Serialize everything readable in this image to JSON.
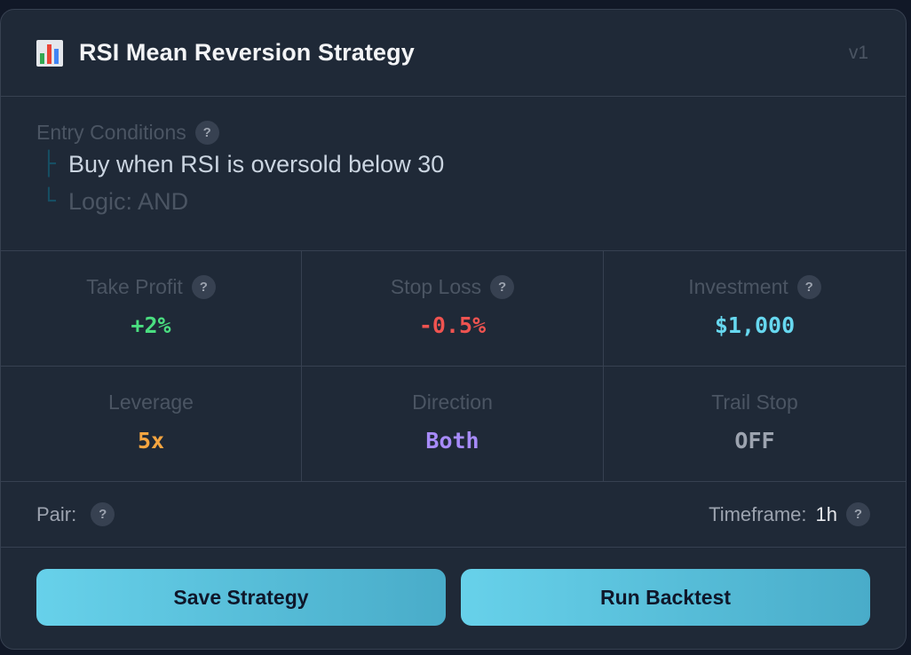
{
  "header": {
    "title": "RSI Mean Reversion Strategy",
    "version": "v1",
    "icon": "bar-chart-icon"
  },
  "entry": {
    "label": "Entry Conditions",
    "help": "?",
    "condition_branch": "├",
    "condition": "Buy when RSI is oversold below 30",
    "logic_branch": "└",
    "logic": "Logic: AND"
  },
  "params": [
    {
      "label": "Take Profit",
      "value": "+2%",
      "color": "#4ade80",
      "help": "?"
    },
    {
      "label": "Stop Loss",
      "value": "-0.5%",
      "color": "#ef5350",
      "help": "?"
    },
    {
      "label": "Investment",
      "value": "$1,000",
      "color": "#67d8f0",
      "help": "?"
    },
    {
      "label": "Leverage",
      "value": "5x",
      "color": "#f5a540"
    },
    {
      "label": "Direction",
      "value": "Both",
      "color": "#a78bfa"
    },
    {
      "label": "Trail Stop",
      "value": "OFF",
      "color": "#9ca3af"
    }
  ],
  "pair": {
    "label": "Pair:",
    "help": "?"
  },
  "timeframe": {
    "label": "Timeframe:",
    "value": "1h",
    "help": "?"
  },
  "actions": {
    "save_label": "Save Strategy",
    "backtest_label": "Run Backtest"
  },
  "colors": {
    "accent": "#5cc4e0",
    "card_bg": "#1f2937",
    "page_bg": "#111827"
  }
}
